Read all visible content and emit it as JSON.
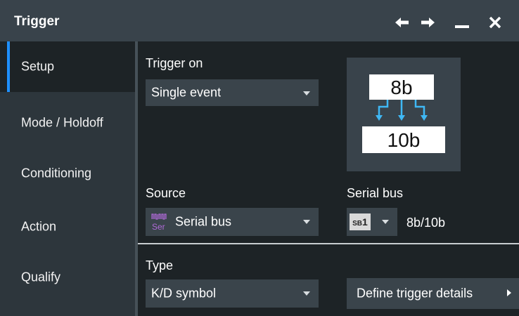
{
  "window": {
    "title": "Trigger",
    "icons": [
      "arrow-left-icon",
      "arrow-right-icon",
      "minimize-icon",
      "close-icon"
    ]
  },
  "sidebar": {
    "items": [
      {
        "label": "Setup",
        "active": true
      },
      {
        "label": "Mode / Holdoff",
        "active": false
      },
      {
        "label": "Conditioning",
        "active": false
      },
      {
        "label": "Action",
        "active": false
      },
      {
        "label": "Qualify",
        "active": false
      }
    ]
  },
  "trigger_on": {
    "label": "Trigger on",
    "value": "Single event"
  },
  "diagram": {
    "top": "8b",
    "bottom": "10b"
  },
  "source": {
    "label": "Source",
    "value": "Serial bus",
    "icon_text": "Ser"
  },
  "serial_bus": {
    "label": "Serial bus",
    "badge_prefix": "SB",
    "badge_num": "1",
    "value": "8b/10b"
  },
  "type": {
    "label": "Type",
    "value": "K/D symbol"
  },
  "define_button": {
    "label": "Define trigger details"
  },
  "colors": {
    "accent": "#1e90ff",
    "arrow": "#3fb8f5",
    "ser_icon": "#b06ad8"
  }
}
